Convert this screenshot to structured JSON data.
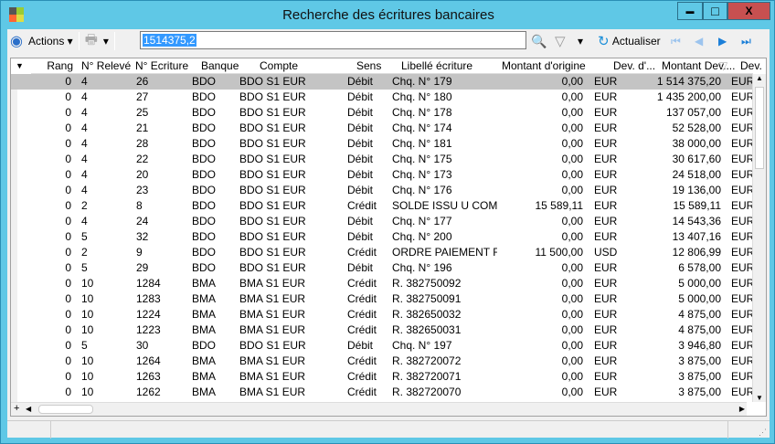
{
  "window": {
    "title": "Recherche des écritures bancaires",
    "minimize": "▬",
    "maximize": "□",
    "close": "X"
  },
  "toolbar": {
    "actions_label": "Actions",
    "search_value": "1514375,2",
    "refresh_label": "Actualiser"
  },
  "columns": [
    "Rang",
    "N° Relevé",
    "N° Ecriture",
    "Banque",
    "Compte",
    "Sens",
    "Libellé écriture",
    "Montant d'origine",
    "Dev. d'...",
    "Montant Dev....",
    "Dev."
  ],
  "rows": [
    [
      "0",
      "4",
      "26",
      "BDO",
      "BDO S1 EUR",
      "Débit",
      "Chq. N° 179",
      "0,00",
      "EUR",
      "1 514 375,20",
      "EUR"
    ],
    [
      "0",
      "4",
      "27",
      "BDO",
      "BDO S1 EUR",
      "Débit",
      "Chq. N° 180",
      "0,00",
      "EUR",
      "1 435 200,00",
      "EUR"
    ],
    [
      "0",
      "4",
      "25",
      "BDO",
      "BDO S1 EUR",
      "Débit",
      "Chq. N° 178",
      "0,00",
      "EUR",
      "137 057,00",
      "EUR"
    ],
    [
      "0",
      "4",
      "21",
      "BDO",
      "BDO S1 EUR",
      "Débit",
      "Chq. N° 174",
      "0,00",
      "EUR",
      "52 528,00",
      "EUR"
    ],
    [
      "0",
      "4",
      "28",
      "BDO",
      "BDO S1 EUR",
      "Débit",
      "Chq. N° 181",
      "0,00",
      "EUR",
      "38 000,00",
      "EUR"
    ],
    [
      "0",
      "4",
      "22",
      "BDO",
      "BDO S1 EUR",
      "Débit",
      "Chq. N° 175",
      "0,00",
      "EUR",
      "30 617,60",
      "EUR"
    ],
    [
      "0",
      "4",
      "20",
      "BDO",
      "BDO S1 EUR",
      "Débit",
      "Chq. N° 173",
      "0,00",
      "EUR",
      "24 518,00",
      "EUR"
    ],
    [
      "0",
      "4",
      "23",
      "BDO",
      "BDO S1 EUR",
      "Débit",
      "Chq. N° 176",
      "0,00",
      "EUR",
      "19 136,00",
      "EUR"
    ],
    [
      "0",
      "2",
      "8",
      "BDO",
      "BDO S1 EUR",
      "Crédit",
      "SOLDE ISSU U COMPT",
      "15 589,11",
      "EUR",
      "15 589,11",
      "EUR"
    ],
    [
      "0",
      "4",
      "24",
      "BDO",
      "BDO S1 EUR",
      "Débit",
      "Chq. N° 177",
      "0,00",
      "EUR",
      "14 543,36",
      "EUR"
    ],
    [
      "0",
      "5",
      "32",
      "BDO",
      "BDO S1 EUR",
      "Débit",
      "Chq. N° 200",
      "0,00",
      "EUR",
      "13 407,16",
      "EUR"
    ],
    [
      "0",
      "2",
      "9",
      "BDO",
      "BDO S1 EUR",
      "Crédit",
      "ORDRE PAIEMENT RE",
      "11 500,00",
      "USD",
      "12 806,99",
      "EUR"
    ],
    [
      "0",
      "5",
      "29",
      "BDO",
      "BDO S1 EUR",
      "Débit",
      "Chq. N° 196",
      "0,00",
      "EUR",
      "6 578,00",
      "EUR"
    ],
    [
      "0",
      "10",
      "1284",
      "BMA",
      "BMA S1 EUR",
      "Crédit",
      "R. 382750092",
      "0,00",
      "EUR",
      "5 000,00",
      "EUR"
    ],
    [
      "0",
      "10",
      "1283",
      "BMA",
      "BMA S1 EUR",
      "Crédit",
      "R. 382750091",
      "0,00",
      "EUR",
      "5 000,00",
      "EUR"
    ],
    [
      "0",
      "10",
      "1224",
      "BMA",
      "BMA S1 EUR",
      "Crédit",
      "R. 382650032",
      "0,00",
      "EUR",
      "4 875,00",
      "EUR"
    ],
    [
      "0",
      "10",
      "1223",
      "BMA",
      "BMA S1 EUR",
      "Crédit",
      "R. 382650031",
      "0,00",
      "EUR",
      "4 875,00",
      "EUR"
    ],
    [
      "0",
      "5",
      "30",
      "BDO",
      "BDO S1 EUR",
      "Débit",
      "Chq. N° 197",
      "0,00",
      "EUR",
      "3 946,80",
      "EUR"
    ],
    [
      "0",
      "10",
      "1264",
      "BMA",
      "BMA S1 EUR",
      "Crédit",
      "R. 382720072",
      "0,00",
      "EUR",
      "3 875,00",
      "EUR"
    ],
    [
      "0",
      "10",
      "1263",
      "BMA",
      "BMA S1 EUR",
      "Crédit",
      "R. 382720071",
      "0,00",
      "EUR",
      "3 875,00",
      "EUR"
    ],
    [
      "0",
      "10",
      "1262",
      "BMA",
      "BMA S1 EUR",
      "Crédit",
      "R. 382720070",
      "0,00",
      "EUR",
      "3 875,00",
      "EUR"
    ]
  ],
  "colors": {
    "frame": "#5fc8e6",
    "selected_row": "#c4c4c4",
    "close": "#c75050"
  }
}
